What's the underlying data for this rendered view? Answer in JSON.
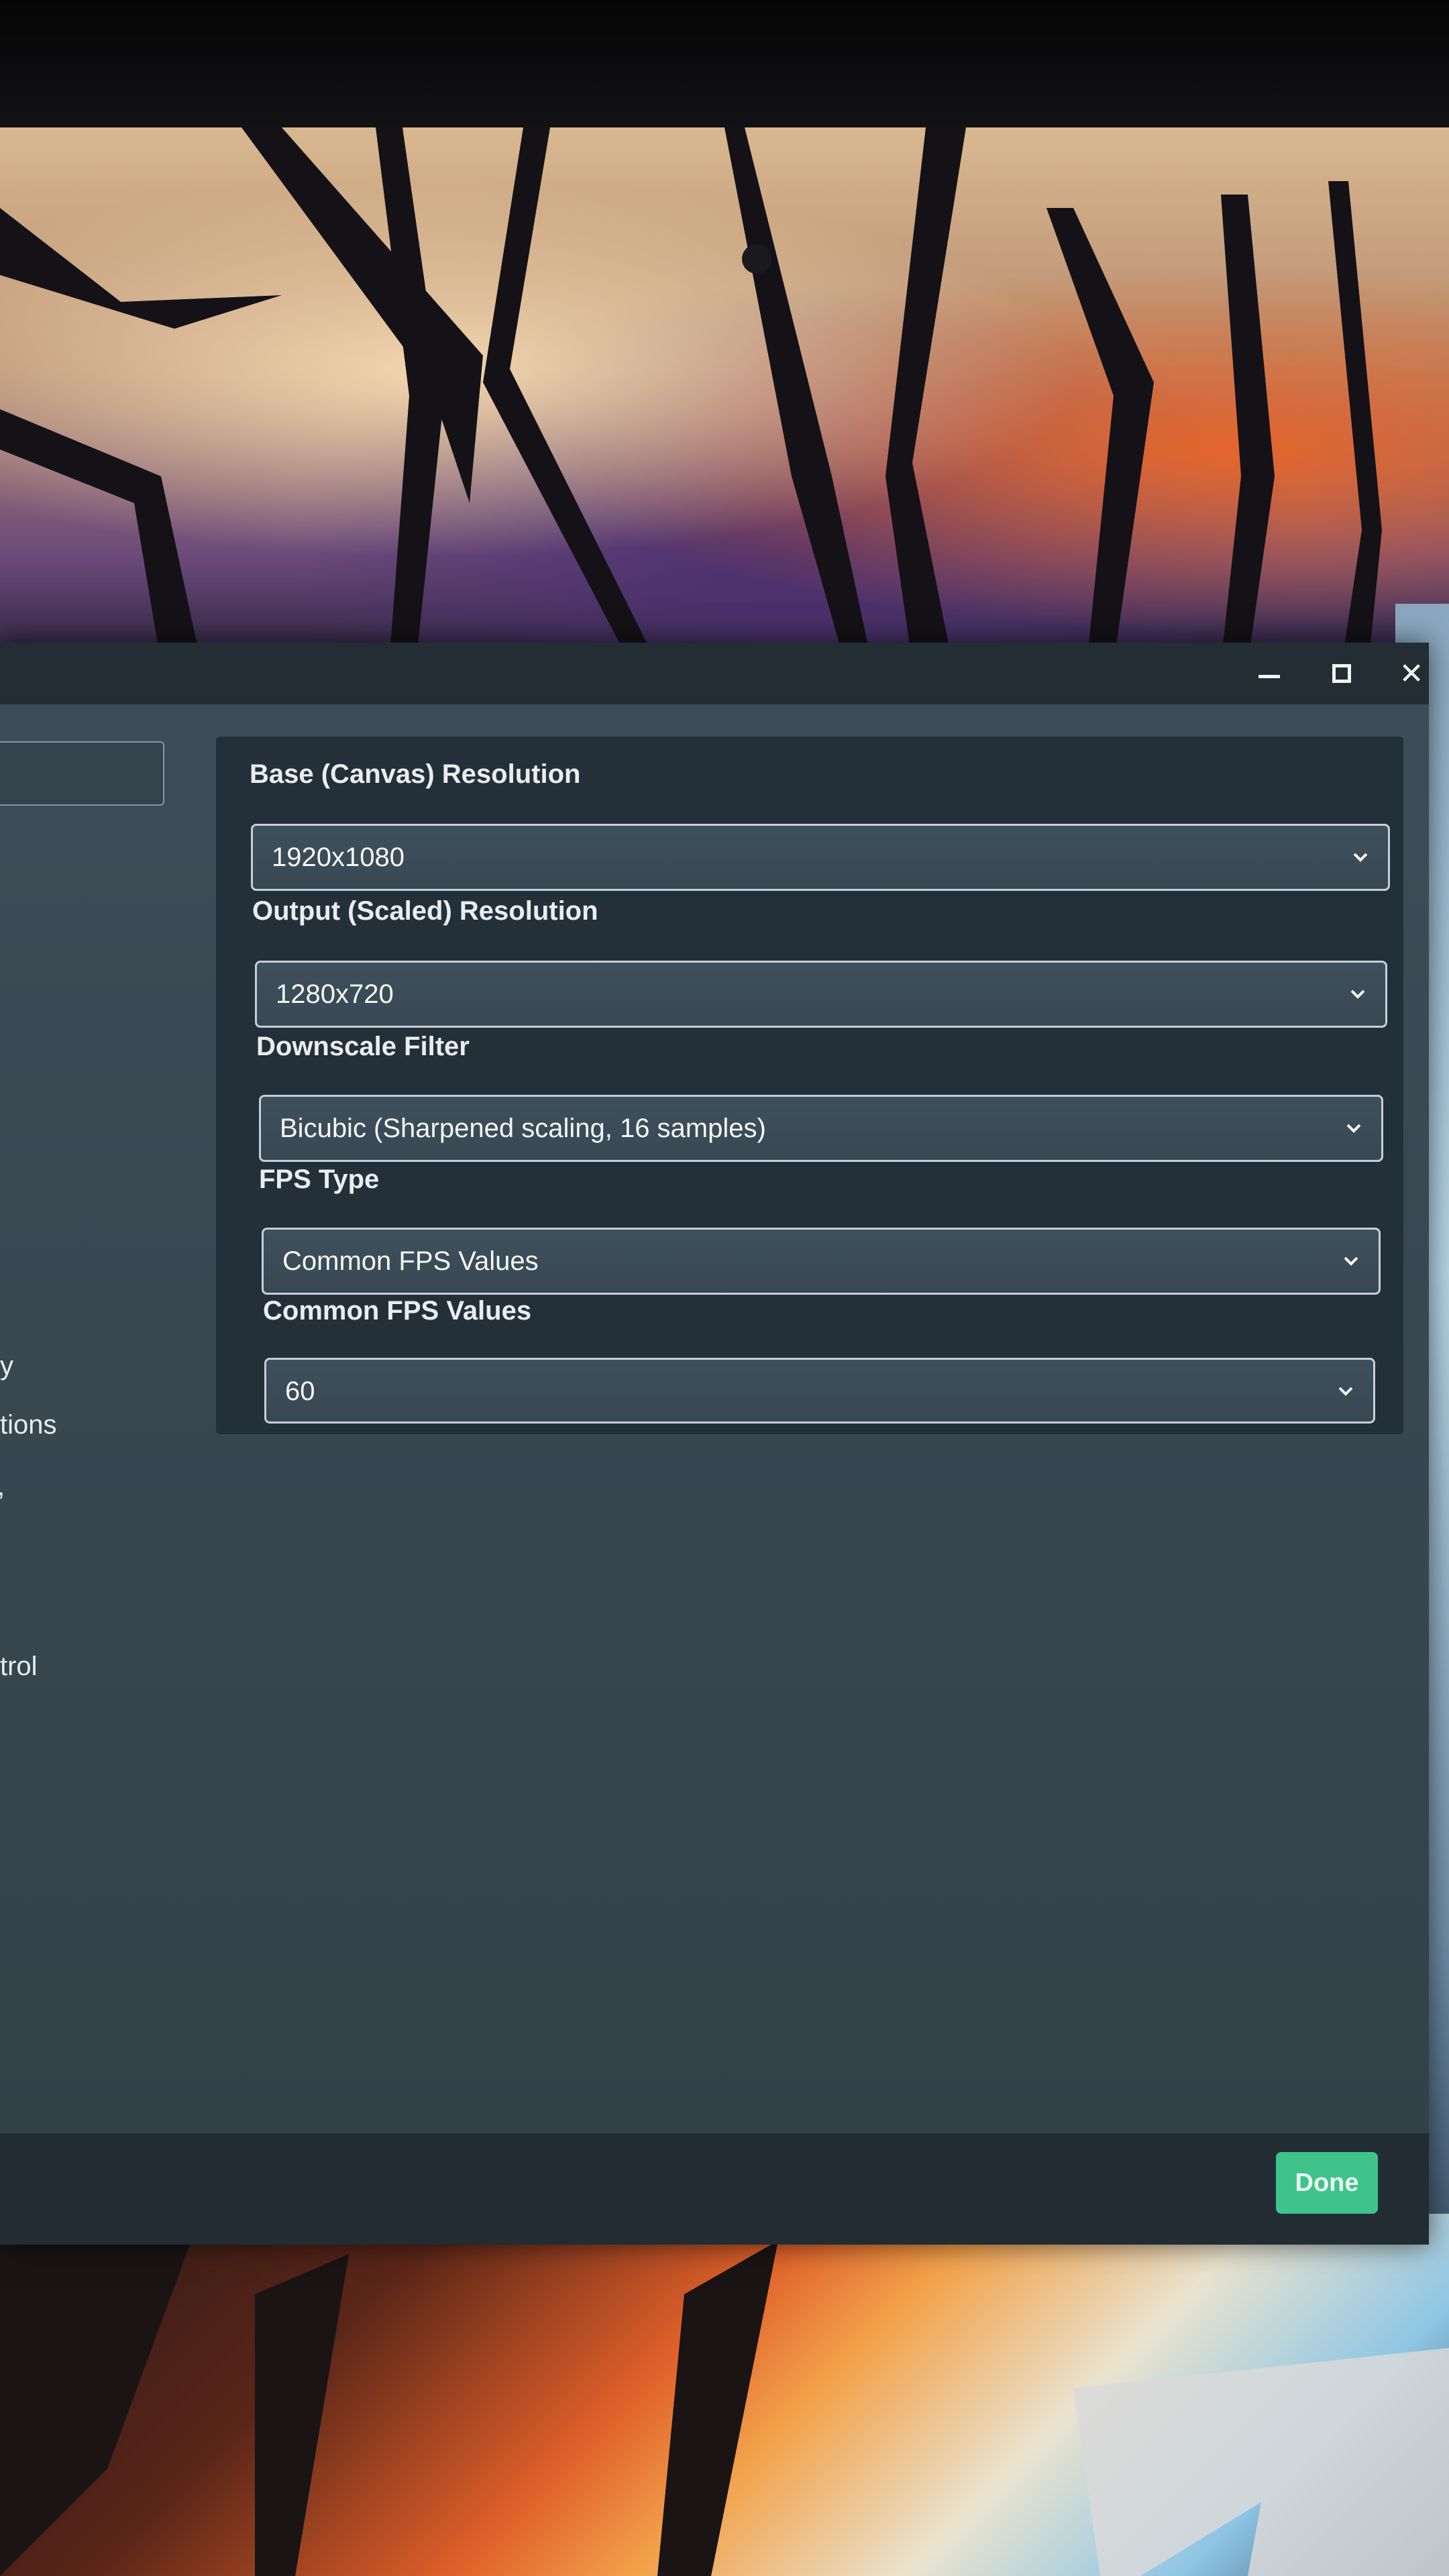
{
  "window": {
    "controls": {
      "minimize_icon": "minimize-icon",
      "maximize_icon": "maximize-icon",
      "close_icon": "close-icon",
      "close_glyph": "✕"
    }
  },
  "sidebar": {
    "items": [
      {
        "label": "y"
      },
      {
        "label": "tions"
      },
      {
        "label": ","
      },
      {
        "label": "trol"
      }
    ]
  },
  "video_settings": {
    "base_resolution": {
      "label": "Base (Canvas) Resolution",
      "value": "1920x1080"
    },
    "output_resolution": {
      "label": "Output (Scaled) Resolution",
      "value": "1280x720"
    },
    "downscale_filter": {
      "label": "Downscale Filter",
      "value": "Bicubic (Sharpened scaling, 16 samples)"
    },
    "fps_type": {
      "label": "FPS Type",
      "value": "Common FPS Values"
    },
    "common_fps": {
      "label": "Common FPS Values",
      "value": "60"
    }
  },
  "footer": {
    "done_label": "Done"
  },
  "colors": {
    "accent": "#3ec38a",
    "panel": "#233039",
    "window": "#2f3e47"
  }
}
